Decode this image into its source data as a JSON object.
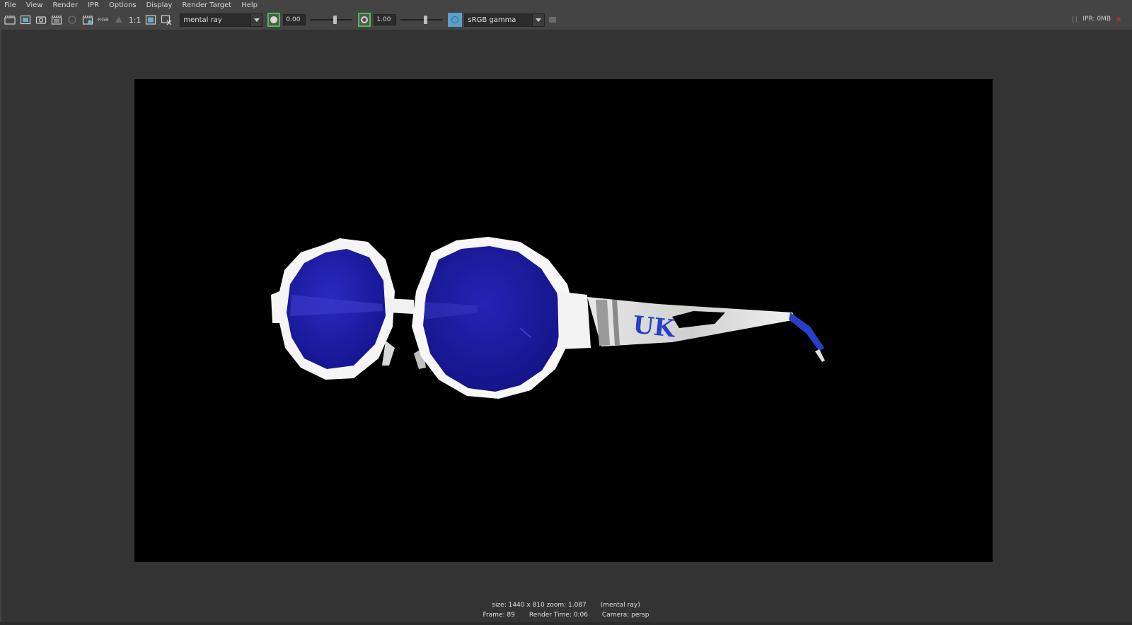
{
  "menubar": {
    "items": [
      "File",
      "View",
      "Render",
      "IPR",
      "Options",
      "Display",
      "Render Target",
      "Help"
    ]
  },
  "toolbar": {
    "rgb_label": "RGB",
    "ratio_label": "1:1",
    "renderer": "mental ray",
    "exposure": "0.00",
    "exposure_level": 0.55,
    "gamma": "1.00",
    "gamma_level": 0.55,
    "color_management": "sRGB gamma",
    "ipr_memory": "IPR: 0MB"
  },
  "render": {
    "logo_text": "UK",
    "lens_color": "#1a1aa8",
    "frame_color": "#ffffff",
    "accent_color": "#2a3fc8"
  },
  "status": {
    "size_zoom": "size: 1440 x 810 zoom: 1.087",
    "renderer": "(mental ray)",
    "frame": "Frame: 89",
    "render_time": "Render Time: 0:06",
    "camera": "Camera: persp"
  }
}
